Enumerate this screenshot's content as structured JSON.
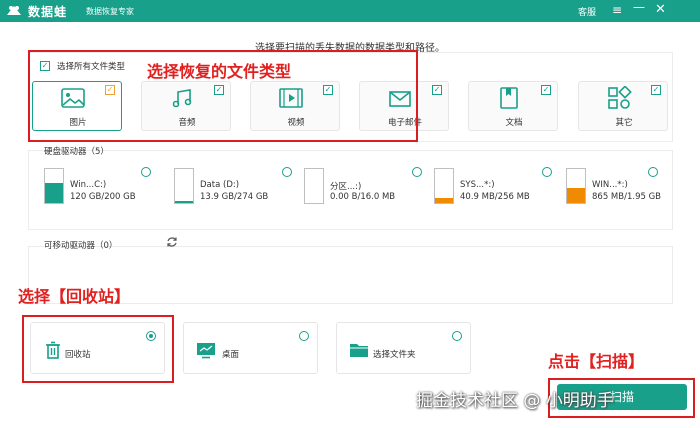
{
  "titlebar": {
    "app_name": "数据蛙",
    "subtitle": "数据恢复专家",
    "service": "客服",
    "menu_icon": "≡",
    "min_icon": "—",
    "close_icon": "✕"
  },
  "instruction": "选择要扫描的丢失数据的数据类型和路径。",
  "file_types": {
    "select_all_label": "选择所有文件类型",
    "items": [
      {
        "label": "图片",
        "icon": "image-icon",
        "checked": true
      },
      {
        "label": "音频",
        "icon": "audio-icon",
        "checked": true
      },
      {
        "label": "视频",
        "icon": "video-icon",
        "checked": true
      },
      {
        "label": "电子邮件",
        "icon": "email-icon",
        "checked": true
      },
      {
        "label": "文档",
        "icon": "document-icon",
        "checked": true
      },
      {
        "label": "其它",
        "icon": "other-icon",
        "checked": true
      }
    ]
  },
  "hard_drives": {
    "title": "硬盘驱动器（5）",
    "items": [
      {
        "name": "Win...C:)",
        "size": "120 GB/200 GB",
        "used_fraction": 0.6,
        "color": "#18a08a"
      },
      {
        "name": "Data (D:)",
        "size": "13.9 GB/274 GB",
        "used_fraction": 0.05,
        "color": "#18a08a"
      },
      {
        "name": "分区...:)",
        "size": "0.00  B/16.0 MB",
        "used_fraction": 0.0,
        "color": "#f08a00"
      },
      {
        "name": "SYS...*:)",
        "size": "40.9 MB/256 MB",
        "used_fraction": 0.16,
        "color": "#f08a00"
      },
      {
        "name": "WIN...*:)",
        "size": "865 MB/1.95 GB",
        "used_fraction": 0.44,
        "color": "#f08a00"
      }
    ]
  },
  "removable": {
    "title": "可移动驱动器（0）"
  },
  "locations": [
    {
      "label": "回收站",
      "icon": "trash-icon",
      "selected": true
    },
    {
      "label": "桌面",
      "icon": "desktop-icon",
      "selected": false
    },
    {
      "label": "选择文件夹",
      "icon": "folder-icon",
      "selected": false
    }
  ],
  "annotations": {
    "types_note": "选择恢复的文件类型",
    "recycle_note": "选择【回收站】",
    "scan_note": "点击【扫描】"
  },
  "scan_button_label": "扫描",
  "watermark": "掘金技术社区 @ 小明助手",
  "colors": {
    "accent": "#18a08a",
    "orange": "#f08a00",
    "annotation": "#d81e1e"
  }
}
